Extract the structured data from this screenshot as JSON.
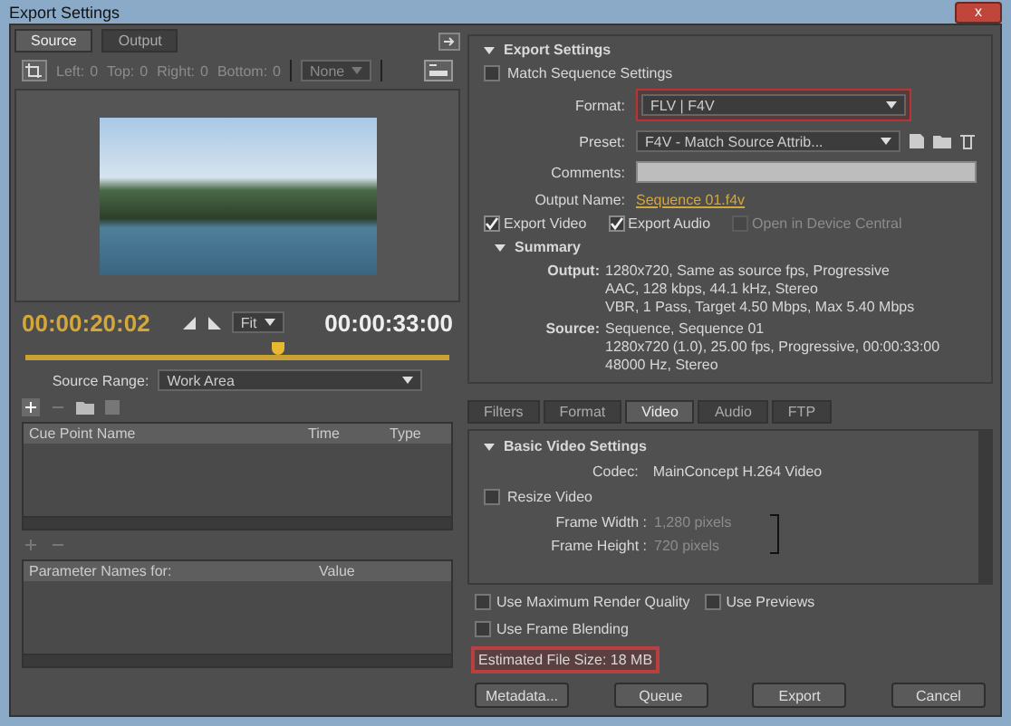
{
  "window": {
    "title": "Export Settings",
    "close_label": "x"
  },
  "source_panel": {
    "tabs": [
      {
        "label": "Source",
        "selected": true
      },
      {
        "label": "Output",
        "selected": false
      }
    ],
    "crop_fields": [
      {
        "label": "Left:",
        "value": "0"
      },
      {
        "label": "Top:",
        "value": "0"
      },
      {
        "label": "Right:",
        "value": "0"
      },
      {
        "label": "Bottom:",
        "value": "0"
      }
    ],
    "crop_disabled": true,
    "aspect_dropdown": {
      "value": "None"
    },
    "current_time": "00:00:20:02",
    "zoom_dropdown": {
      "value": "Fit"
    },
    "duration": "00:00:33:00",
    "playhead": {
      "level": 0.6
    },
    "source_range": {
      "label": "Source Range:",
      "value": "Work Area"
    },
    "cue_table": {
      "columns": [
        "Cue Point Name",
        "Time",
        "Type"
      ]
    },
    "param_table": {
      "columns": [
        "Parameter Names for:",
        "Value"
      ]
    }
  },
  "export_settings": {
    "heading": "Export Settings",
    "expanded": true,
    "match_sequence": {
      "label": "Match Sequence Settings",
      "checked": false
    },
    "format": {
      "label": "Format:",
      "value": "FLV | F4V",
      "highlighted": true
    },
    "preset": {
      "label": "Preset:",
      "value": "F4V - Match Source Attrib..."
    },
    "comments": {
      "label": "Comments:"
    },
    "output_name": {
      "label": "Output Name:",
      "value": "Sequence 01.f4v"
    },
    "export_options": [
      {
        "label": "Export Video",
        "checked": true,
        "disabled": false
      },
      {
        "label": "Export Audio",
        "checked": true,
        "disabled": false
      },
      {
        "label": "Open in Device Central",
        "checked": false,
        "disabled": true
      }
    ],
    "summary": {
      "heading": "Summary",
      "expanded": true,
      "groups": [
        {
          "label": "Output:",
          "lines": [
            "1280x720, Same as source fps, Progressive",
            "AAC, 128 kbps, 44.1 kHz, Stereo",
            "VBR, 1 Pass, Target 4.50 Mbps, Max 5.40 Mbps"
          ]
        },
        {
          "label": "Source:",
          "lines": [
            "Sequence, Sequence 01",
            "1280x720 (1.0), 25.00 fps, Progressive, 00:00:33:00",
            "48000 Hz, Stereo"
          ]
        }
      ]
    }
  },
  "settings_tabs": [
    {
      "label": "Filters",
      "selected": false
    },
    {
      "label": "Format",
      "selected": false
    },
    {
      "label": "Video",
      "selected": true
    },
    {
      "label": "Audio",
      "selected": false
    },
    {
      "label": "FTP",
      "selected": false
    }
  ],
  "basic_video": {
    "heading": "Basic Video Settings",
    "expanded": true,
    "codec": {
      "label": "Codec:",
      "value": "MainConcept H.264 Video"
    },
    "resize": {
      "label": "Resize Video",
      "checked": false
    },
    "frame_width": {
      "label": "Frame Width :",
      "value": "1,280 pixels"
    },
    "frame_height": {
      "label": "Frame Height :",
      "value": "720 pixels"
    }
  },
  "render_options": [
    {
      "label": "Use Maximum Render Quality",
      "checked": false
    },
    {
      "label": "Use Previews",
      "checked": false
    },
    {
      "label": "Use Frame Blending",
      "checked": false
    }
  ],
  "estimated_size": {
    "text": "Estimated File Size: 18 MB",
    "highlighted": true
  },
  "buttons": [
    "Metadata...",
    "Queue",
    "Export",
    "Cancel"
  ]
}
